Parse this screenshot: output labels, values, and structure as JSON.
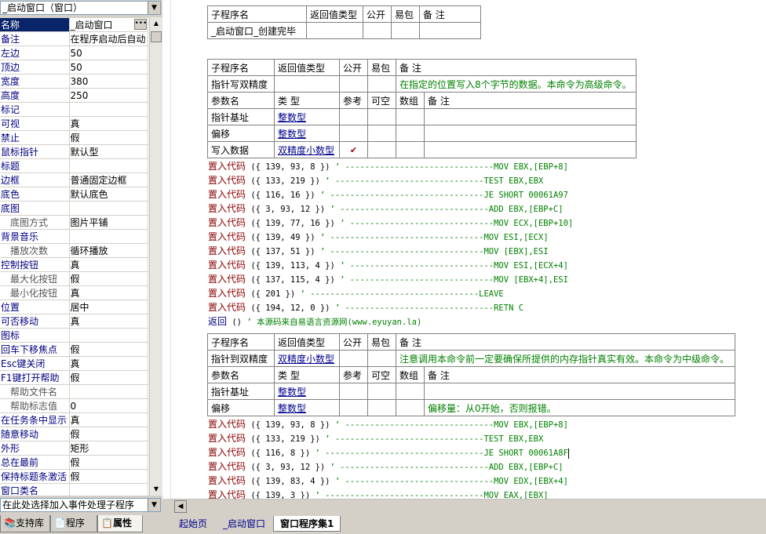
{
  "left": {
    "object_combo": "_启动窗口（窗口）",
    "properties": [
      {
        "k": "名称",
        "v": "_启动窗口",
        "sel": true,
        "btn": true
      },
      {
        "k": "备注",
        "v": "在程序启动后自动"
      },
      {
        "k": "左边",
        "v": "50"
      },
      {
        "k": "顶边",
        "v": "50"
      },
      {
        "k": "宽度",
        "v": "380"
      },
      {
        "k": "高度",
        "v": "250"
      },
      {
        "k": "标记",
        "v": ""
      },
      {
        "k": "可视",
        "v": "真"
      },
      {
        "k": "禁止",
        "v": "假"
      },
      {
        "k": "鼠标指针",
        "v": "默认型"
      },
      {
        "k": "标题",
        "v": ""
      },
      {
        "k": "边框",
        "v": "普通固定边框"
      },
      {
        "k": "底色",
        "v": "默认底色"
      },
      {
        "k": "底图",
        "v": ""
      },
      {
        "k": "底图方式",
        "v": "图片平铺",
        "sub": true
      },
      {
        "k": "背景音乐",
        "v": ""
      },
      {
        "k": "播放次数",
        "v": "循环播放",
        "sub": true
      },
      {
        "k": "控制按钮",
        "v": "真"
      },
      {
        "k": "最大化按钮",
        "v": "假",
        "sub": true
      },
      {
        "k": "最小化按钮",
        "v": "真",
        "sub": true
      },
      {
        "k": "位置",
        "v": "居中"
      },
      {
        "k": "可否移动",
        "v": "真"
      },
      {
        "k": "图标",
        "v": ""
      },
      {
        "k": "回车下移焦点",
        "v": "假"
      },
      {
        "k": "Esc键关闭",
        "v": "真"
      },
      {
        "k": "F1键打开帮助",
        "v": "假"
      },
      {
        "k": "帮助文件名",
        "v": "",
        "sub": true
      },
      {
        "k": "帮助标志值",
        "v": "0",
        "sub": true
      },
      {
        "k": "在任务条中显示",
        "v": "真"
      },
      {
        "k": "随意移动",
        "v": "假"
      },
      {
        "k": "外形",
        "v": "矩形"
      },
      {
        "k": "总在最前",
        "v": "假"
      },
      {
        "k": "保持标题条激活",
        "v": "假"
      },
      {
        "k": "窗口类名",
        "v": ""
      }
    ],
    "event_combo": "在此处选择加入事件处理子程序",
    "tabs": [
      "支持库",
      "程序",
      "属性"
    ]
  },
  "editor": {
    "t1": {
      "header": [
        "子程序名",
        "返回值类型",
        "公开",
        "易包",
        "备 注"
      ],
      "row": [
        "_启动窗口_创建完毕",
        "",
        "",
        "",
        ""
      ]
    },
    "t2": {
      "header": [
        "子程序名",
        "返回值类型",
        "公开",
        "易包",
        "备 注"
      ],
      "row": [
        "指针写双精度",
        "",
        "",
        "",
        "在指定的位置写入8个字节的数据。本命令为高级命令。"
      ],
      "pheader": [
        "参数名",
        "类 型",
        "参考",
        "可空",
        "数组",
        "备 注"
      ],
      "params": [
        [
          "指针基址",
          "整数型",
          "",
          "",
          "",
          ""
        ],
        [
          "偏移",
          "整数型",
          "",
          "",
          "",
          ""
        ],
        [
          "写入数据",
          "双精度小数型",
          "✔",
          "",
          "",
          ""
        ]
      ]
    },
    "code1": [
      {
        "kw": "置入代码",
        "arg": " ({ 139, 93, 8 }) ",
        "cm": "’ ------------------------------MOV EBX,[EBP+8]"
      },
      {
        "kw": "置入代码",
        "arg": " ({ 133, 219 }) ",
        "cm": "’ ------------------------------TEST EBX,EBX"
      },
      {
        "kw": "置入代码",
        "arg": " ({ 116, 16 }) ",
        "cm": "’ -------------------------------JE SHORT 00061A97"
      },
      {
        "kw": "置入代码",
        "arg": " ({ 3, 93, 12 }) ",
        "cm": "’ ------------------------------ADD EBX,[EBP+C]"
      },
      {
        "kw": "置入代码",
        "arg": " ({ 139, 77, 16 }) ",
        "cm": "’ -----------------------------MOV ECX,[EBP+10]"
      },
      {
        "kw": "置入代码",
        "arg": " ({ 139, 49 }) ",
        "cm": "’ -------------------------------MOV ESI,[ECX]"
      },
      {
        "kw": "置入代码",
        "arg": " ({ 137, 51 }) ",
        "cm": "’ -------------------------------MOV [EBX],ESI"
      },
      {
        "kw": "置入代码",
        "arg": " ({ 139, 113, 4 }) ",
        "cm": "’ -----------------------------MOV ESI,[ECX+4]"
      },
      {
        "kw": "置入代码",
        "arg": " ({ 137, 115, 4 }) ",
        "cm": "’ -----------------------------MOV [EBX+4],ESI"
      },
      {
        "kw": "置入代码",
        "arg": " ({ 201 }) ",
        "cm": "’ ----------------------------------LEAVE"
      },
      {
        "kw": "置入代码",
        "arg": " ({ 194, 12, 0 }) ",
        "cm": "’ ------------------------------RETN C"
      }
    ],
    "return_line": {
      "kw": "返回",
      "arg": " () ",
      "cm": "’ 本源码来自易语言资源网(www.eyuyan.la)"
    },
    "t3": {
      "header": [
        "子程序名",
        "返回值类型",
        "公开",
        "易包",
        "备 注"
      ],
      "row": [
        "指针到双精度",
        "双精度小数型",
        "",
        "",
        "注意调用本命令前一定要确保所提供的内存指针真实有效。本命令为中级命令。"
      ],
      "pheader": [
        "参数名",
        "类 型",
        "参考",
        "可空",
        "数组",
        "备 注"
      ],
      "params": [
        [
          "指针基址",
          "整数型",
          "",
          "",
          "",
          ""
        ],
        [
          "偏移",
          "整数型",
          "",
          "",
          "",
          "偏移量：从0开始，否则报错。"
        ]
      ]
    },
    "code2": [
      {
        "kw": "置入代码",
        "arg": " ({ 139, 93, 8 }) ",
        "cm": "’ ------------------------------MOV EBX,[EBP+8]"
      },
      {
        "kw": "置入代码",
        "arg": " ({ 133, 219 }) ",
        "cm": "’ ------------------------------TEST EBX,EBX"
      },
      {
        "kw": "置入代码",
        "arg": " ({ 116, 8 }) ",
        "cm": "’ --------------------------------JE SHORT 00061A8F"
      },
      {
        "kw": "置入代码",
        "arg": " ({ 3, 93, 12 }) ",
        "cm": "’ ------------------------------ADD EBX,[EBP+C]"
      },
      {
        "kw": "置入代码",
        "arg": " ({ 139, 83, 4 }) ",
        "cm": "’ ------------------------------MOV EDX,[EBX+4]"
      },
      {
        "kw": "置入代码",
        "arg": " ({ 139, 3 }) ",
        "cm": "’ --------------------------------MOV EAX,[EBX]"
      }
    ]
  },
  "doc_tabs": [
    "起始页",
    "_启动窗口",
    "窗口程序集1"
  ]
}
